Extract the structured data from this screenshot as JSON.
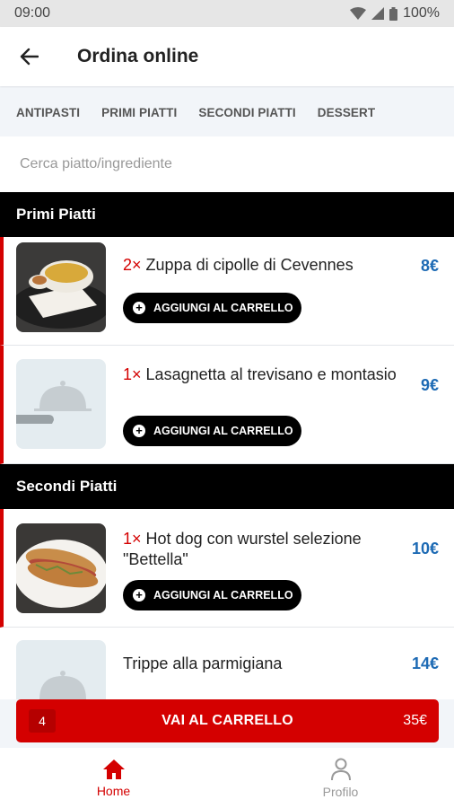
{
  "status_bar": {
    "time": "09:00",
    "battery": "100%"
  },
  "app_bar": {
    "title": "Ordina online"
  },
  "tabs": [
    "ANTIPASTI",
    "PRIMI PIATTI",
    "SECONDI PIATTI",
    "DESSERT"
  ],
  "search": {
    "placeholder": "Cerca piatto/ingrediente",
    "value": ""
  },
  "sections": [
    {
      "title": "Primi Piatti",
      "items": [
        {
          "qty": "2×",
          "name": "Zuppa di cipolle di Cevennes",
          "price": "8€",
          "button": "AGGIUNGI AL CARRELLO",
          "image": "soup-photo"
        },
        {
          "qty": "1×",
          "name": "Lasagnetta al trevisano e montasio",
          "price": "9€",
          "button": "AGGIUNGI AL CARRELLO",
          "image": "cloche-placeholder"
        }
      ]
    },
    {
      "title": "Secondi Piatti",
      "items": [
        {
          "qty": "1×",
          "name": "Hot dog con wurstel selezione \"Bettella\"",
          "price": "10€",
          "button": "AGGIUNGI AL CARRELLO",
          "image": "hotdog-photo"
        },
        {
          "qty": "",
          "name": "Trippe alla parmigiana",
          "price": "14€",
          "image": "cloche-placeholder"
        }
      ]
    }
  ],
  "cart": {
    "count": "4",
    "label": "VAI AL CARRELLO",
    "total": "35€"
  },
  "bottom_nav": [
    {
      "label": "Home",
      "icon": "home-icon",
      "active": true
    },
    {
      "label": "Profilo",
      "icon": "person-icon",
      "active": false
    }
  ],
  "colors": {
    "accent": "#d40000",
    "price": "#1d6ab4",
    "section_bg": "#000000"
  }
}
